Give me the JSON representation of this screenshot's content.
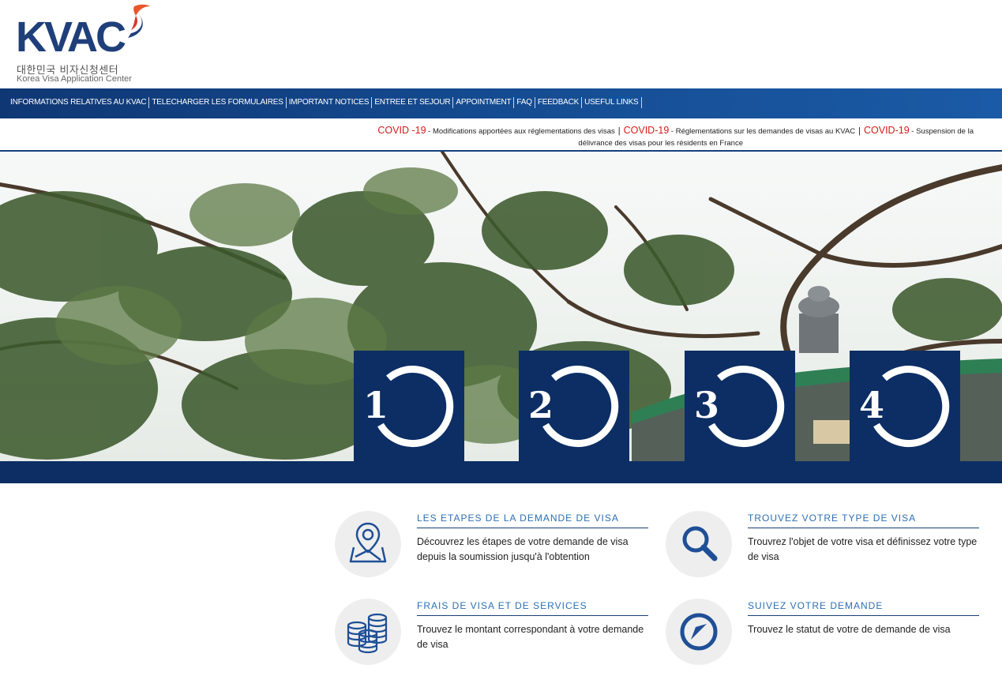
{
  "header": {
    "logo_text": "KVAC",
    "logo_korean": "대한민국 비자신청센터",
    "logo_subtitle": "Korea Visa Application Center"
  },
  "nav": {
    "items": [
      "INFORMATIONS RELATIVES AU KVAC",
      "TELECHARGER LES FORMULAIRES",
      "IMPORTANT NOTICES",
      "ENTREE ET SEJOUR",
      "APPOINTMENT",
      "FAQ",
      "FEEDBACK",
      "USEFUL LINKS"
    ]
  },
  "notice": {
    "items": [
      {
        "tag": "COVID -19",
        "text": " - Modifications apportées aux réglementations des visas"
      },
      {
        "tag": "COVID-19",
        "text": " - Réglementations sur les demandes de visas au KVAC"
      },
      {
        "tag": "COVID-19",
        "text": "  - Suspension de la"
      }
    ],
    "continuation": "délivrance des visas pour les résidents en France",
    "separator": "|"
  },
  "steps": [
    "1",
    "2",
    "3",
    "4"
  ],
  "features": [
    {
      "title": "LES ETAPES DE LA DEMANDE DE VISA",
      "description": "Découvrez les étapes de votre demande de visa depuis la soumission jusqu'à l'obtention",
      "icon": "map-pin-icon"
    },
    {
      "title": "TROUVEZ VOTRE TYPE DE VISA",
      "description": "Trouvrez l'objet de votre visa et définissez votre type de visa",
      "icon": "search-icon"
    },
    {
      "title": "FRAIS DE VISA ET DE SERVICES",
      "description": "Trouvez le montant correspondant à votre demande de visa",
      "icon": "coins-icon"
    },
    {
      "title": "SUIVEZ VOTRE DEMANDE",
      "description": "Trouvez le statut de votre de demande de visa",
      "icon": "compass-icon"
    }
  ],
  "colors": {
    "brand_navy": "#0c2e64",
    "nav_blue": "#164f96",
    "covid_red": "#d41b1b",
    "link_blue": "#2d6fb3",
    "logo_accent": "#e8562a"
  }
}
